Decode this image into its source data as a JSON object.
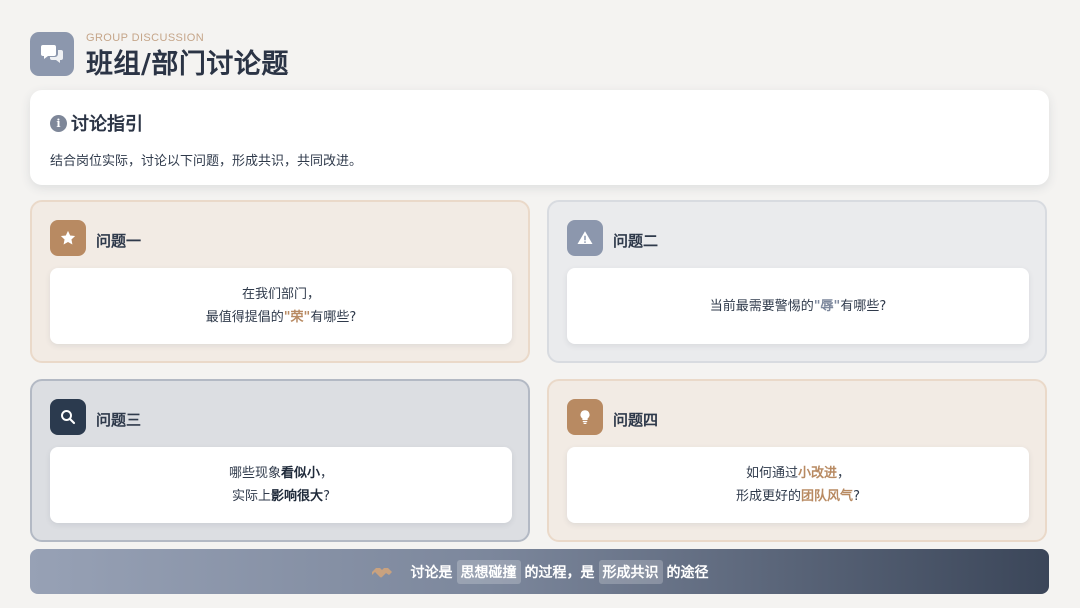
{
  "header": {
    "subtitle": "GROUP DISCUSSION",
    "title": "班组/部门讨论题",
    "icon": "chat-bubbles-icon"
  },
  "guide": {
    "title": "讨论指引",
    "description": "结合岗位实际，讨论以下问题，形成共识，共同改进。",
    "icon": "info-icon"
  },
  "questions": [
    {
      "label": "问题一",
      "icon": "star-icon",
      "line1": "在我们部门，",
      "line2_pre": "最值得提倡的",
      "line2_hl": "\"荣\"",
      "line2_post": "有哪些?"
    },
    {
      "label": "问题二",
      "icon": "warning-icon",
      "line1_pre": "当前最需要警惕的",
      "line1_hl": "\"辱\"",
      "line1_post": "有哪些?"
    },
    {
      "label": "问题三",
      "icon": "search-icon",
      "line1_pre": "哪些现象",
      "line1_hl": "看似小",
      "line1_post": "，",
      "line2_pre": "实际上",
      "line2_hl": "影响很大",
      "line2_post": "?"
    },
    {
      "label": "问题四",
      "icon": "lightbulb-icon",
      "line1_pre": "如何通过",
      "line1_hl": "小改进",
      "line1_post": "，",
      "line2_pre": "形成更好的",
      "line2_hl": "团队风气",
      "line2_post": "?"
    }
  ],
  "banner": {
    "icon": "handshake-icon",
    "part1": "讨论是",
    "chip1": "思想碰撞",
    "part2": "的过程，是",
    "chip2": "形成共识",
    "part3": "的途径"
  },
  "colors": {
    "accent_brown": "#b88a62",
    "accent_slate": "#8c97ad",
    "accent_dark": "#2b3a4e",
    "background": "#f4f3f1"
  }
}
